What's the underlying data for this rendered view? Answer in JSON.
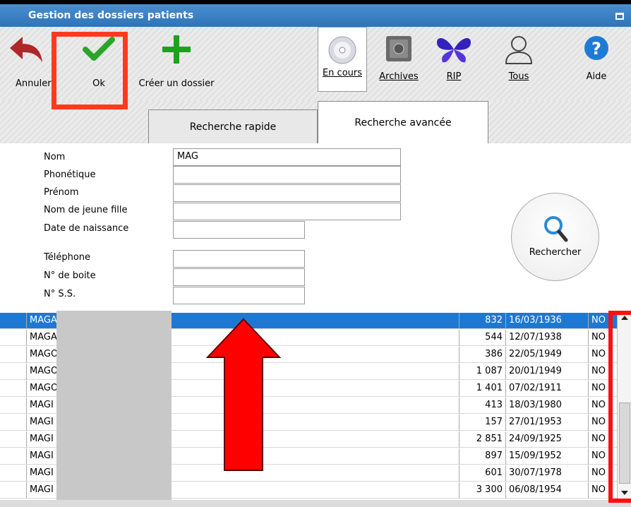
{
  "window": {
    "title": "Gestion des dossiers patients"
  },
  "toolbar": {
    "cancel_label": "Annuler",
    "ok_label": "Ok",
    "create_label": "Créer un dossier",
    "en_cours_label": "En cours",
    "archives_label": "Archives",
    "rip_label": "RIP",
    "tous_label": "Tous",
    "aide_label": "Aide"
  },
  "tabs": {
    "rapide": "Recherche rapide",
    "avancee": "Recherche avancée"
  },
  "form": {
    "nom_label": "Nom",
    "nom_value": "MAG",
    "phonetique_label": "Phonétique",
    "prenom_label": "Prénom",
    "jeune_fille_label": "Nom de jeune fille",
    "naissance_label": "Date de naissance",
    "telephone_label": "Téléphone",
    "boite_label": "N° de boite",
    "ss_label": "N° S.S.",
    "search_label": "Rechercher"
  },
  "results": [
    {
      "name": "MAGA",
      "num": "832",
      "date": "16/03/1936",
      "flag": "NO",
      "selected": true
    },
    {
      "name": "MAGA",
      "num": "544",
      "date": "12/07/1938",
      "flag": "NO"
    },
    {
      "name": "MAGO",
      "num": "386",
      "date": "22/05/1949",
      "flag": "NO"
    },
    {
      "name": "MAGO",
      "num": "1 087",
      "date": "20/01/1949",
      "flag": "NO"
    },
    {
      "name": "MAGO",
      "num": "1 401",
      "date": "07/02/1911",
      "flag": "NO"
    },
    {
      "name": "MAGI",
      "num": "413",
      "date": "18/03/1980",
      "flag": "NO"
    },
    {
      "name": "MAGI",
      "num": "157",
      "date": "27/01/1953",
      "flag": "NO"
    },
    {
      "name": "MAGI",
      "num": "2 851",
      "date": "24/09/1925",
      "flag": "NO"
    },
    {
      "name": "MAGI",
      "num": "897",
      "date": "15/09/1952",
      "flag": "NO"
    },
    {
      "name": "MAGI",
      "num": "601",
      "date": "30/07/1978",
      "flag": "NO"
    },
    {
      "name": "MAGI",
      "num": "3 300",
      "date": "06/08/1954",
      "flag": "NO"
    }
  ],
  "colors": {
    "titlebar": "#3a80c4",
    "selection": "#1e78d2",
    "highlight": "#ff3a1a"
  }
}
